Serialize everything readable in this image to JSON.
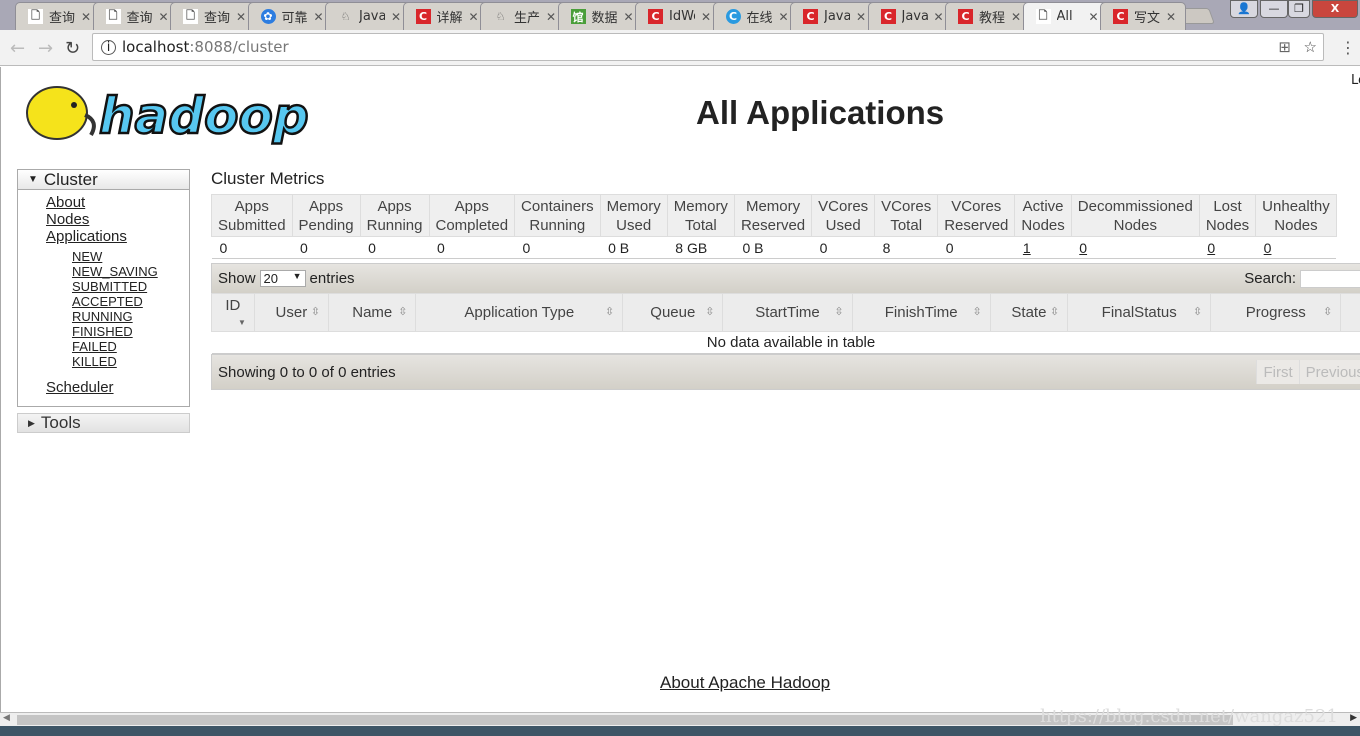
{
  "browser": {
    "tabs": [
      {
        "title": "查询",
        "icon": "page"
      },
      {
        "title": "查询",
        "icon": "page"
      },
      {
        "title": "查询",
        "icon": "page"
      },
      {
        "title": "可靠",
        "icon": "baidu"
      },
      {
        "title": "Java",
        "icon": "github"
      },
      {
        "title": "详解",
        "icon": "csdn"
      },
      {
        "title": "生产",
        "icon": "github"
      },
      {
        "title": "数据",
        "icon": "library"
      },
      {
        "title": "IdWorker",
        "icon": "csdn"
      },
      {
        "title": "在线",
        "icon": "c-blue"
      },
      {
        "title": "Java",
        "icon": "csdn"
      },
      {
        "title": "Java",
        "icon": "csdn"
      },
      {
        "title": "教程",
        "icon": "csdn"
      },
      {
        "title": "All",
        "icon": "page",
        "active": true
      },
      {
        "title": "写文",
        "icon": "csdn"
      }
    ],
    "url_host": "localhost",
    "url_rest": ":8088/cluster"
  },
  "header": {
    "title": "All Applications",
    "login": "Lo"
  },
  "sidebar": {
    "cluster_label": "Cluster",
    "items": [
      "About",
      "Nodes",
      "Applications"
    ],
    "states": [
      "NEW",
      "NEW_SAVING",
      "SUBMITTED",
      "ACCEPTED",
      "RUNNING",
      "FINISHED",
      "FAILED",
      "KILLED"
    ],
    "scheduler": "Scheduler",
    "tools_label": "Tools"
  },
  "metrics": {
    "title": "Cluster Metrics",
    "headers": [
      [
        "Apps",
        "Submitted"
      ],
      [
        "Apps",
        "Pending"
      ],
      [
        "Apps",
        "Running"
      ],
      [
        "Apps",
        "Completed"
      ],
      [
        "Containers",
        "Running"
      ],
      [
        "Memory",
        "Used"
      ],
      [
        "Memory",
        "Total"
      ],
      [
        "Memory",
        "Reserved"
      ],
      [
        "VCores",
        "Used"
      ],
      [
        "VCores",
        "Total"
      ],
      [
        "VCores",
        "Reserved"
      ],
      [
        "Active",
        "Nodes"
      ],
      [
        "Decommissioned",
        "Nodes"
      ],
      [
        "Lost",
        "Nodes"
      ],
      [
        "Unhealthy",
        "Nodes"
      ]
    ],
    "values": [
      "0",
      "0",
      "0",
      "0",
      "0",
      "0 B",
      "8 GB",
      "0 B",
      "0",
      "8",
      "0",
      "1",
      "0",
      "0",
      "0"
    ]
  },
  "apps": {
    "show_label": "Show",
    "entries_label": "entries",
    "page_size": "20",
    "search_label": "Search:",
    "columns": [
      "ID",
      "User",
      "Name",
      "Application Type",
      "Queue",
      "StartTime",
      "FinishTime",
      "State",
      "FinalStatus",
      "Progress",
      ""
    ],
    "empty": "No data available in table",
    "info": "Showing 0 to 0 of 0 entries",
    "first": "First",
    "previous": "Previous"
  },
  "footer": {
    "link": "About Apache Hadoop"
  },
  "watermark": "https://blog.csdn.net/wangaz521"
}
